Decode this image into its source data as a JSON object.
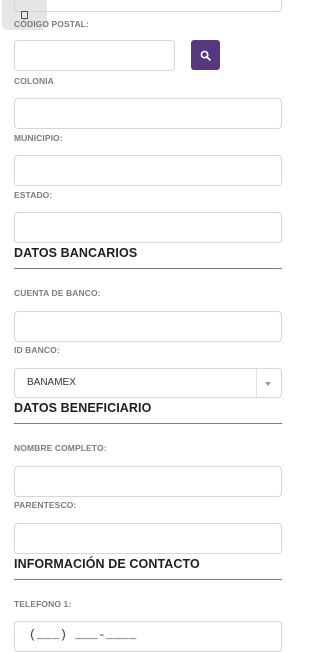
{
  "top_partial_input": {
    "value": ""
  },
  "floating_button": {
    "icon": "square-icon"
  },
  "codigo_postal": {
    "label": "CÓDIGO POSTAL:",
    "value": "",
    "search_icon": "search-icon",
    "search_color": "#55387e"
  },
  "colonia": {
    "label": "COLONIA",
    "value": ""
  },
  "municipio": {
    "label": "MUNICIPIO:",
    "value": ""
  },
  "estado": {
    "label": "ESTADO:",
    "value": ""
  },
  "datos_bancarios": {
    "title": "DATOS BANCARIOS",
    "cuenta_label": "CUENTA DE BANCO:",
    "cuenta_value": "",
    "id_banco_label": "ID BANCO:",
    "id_banco_selected": "BANAMEX"
  },
  "datos_beneficiario": {
    "title": "DATOS BENEFICIARIO",
    "nombre_label": "NOMBRE COMPLETO:",
    "nombre_value": "",
    "parentesco_label": "PARENTESCO:",
    "parentesco_value": ""
  },
  "contacto": {
    "title": "INFORMACIÓN DE CONTACTO",
    "telefono_label": "TELEFONO 1:",
    "telefono_mask": "(___) ___-____"
  }
}
